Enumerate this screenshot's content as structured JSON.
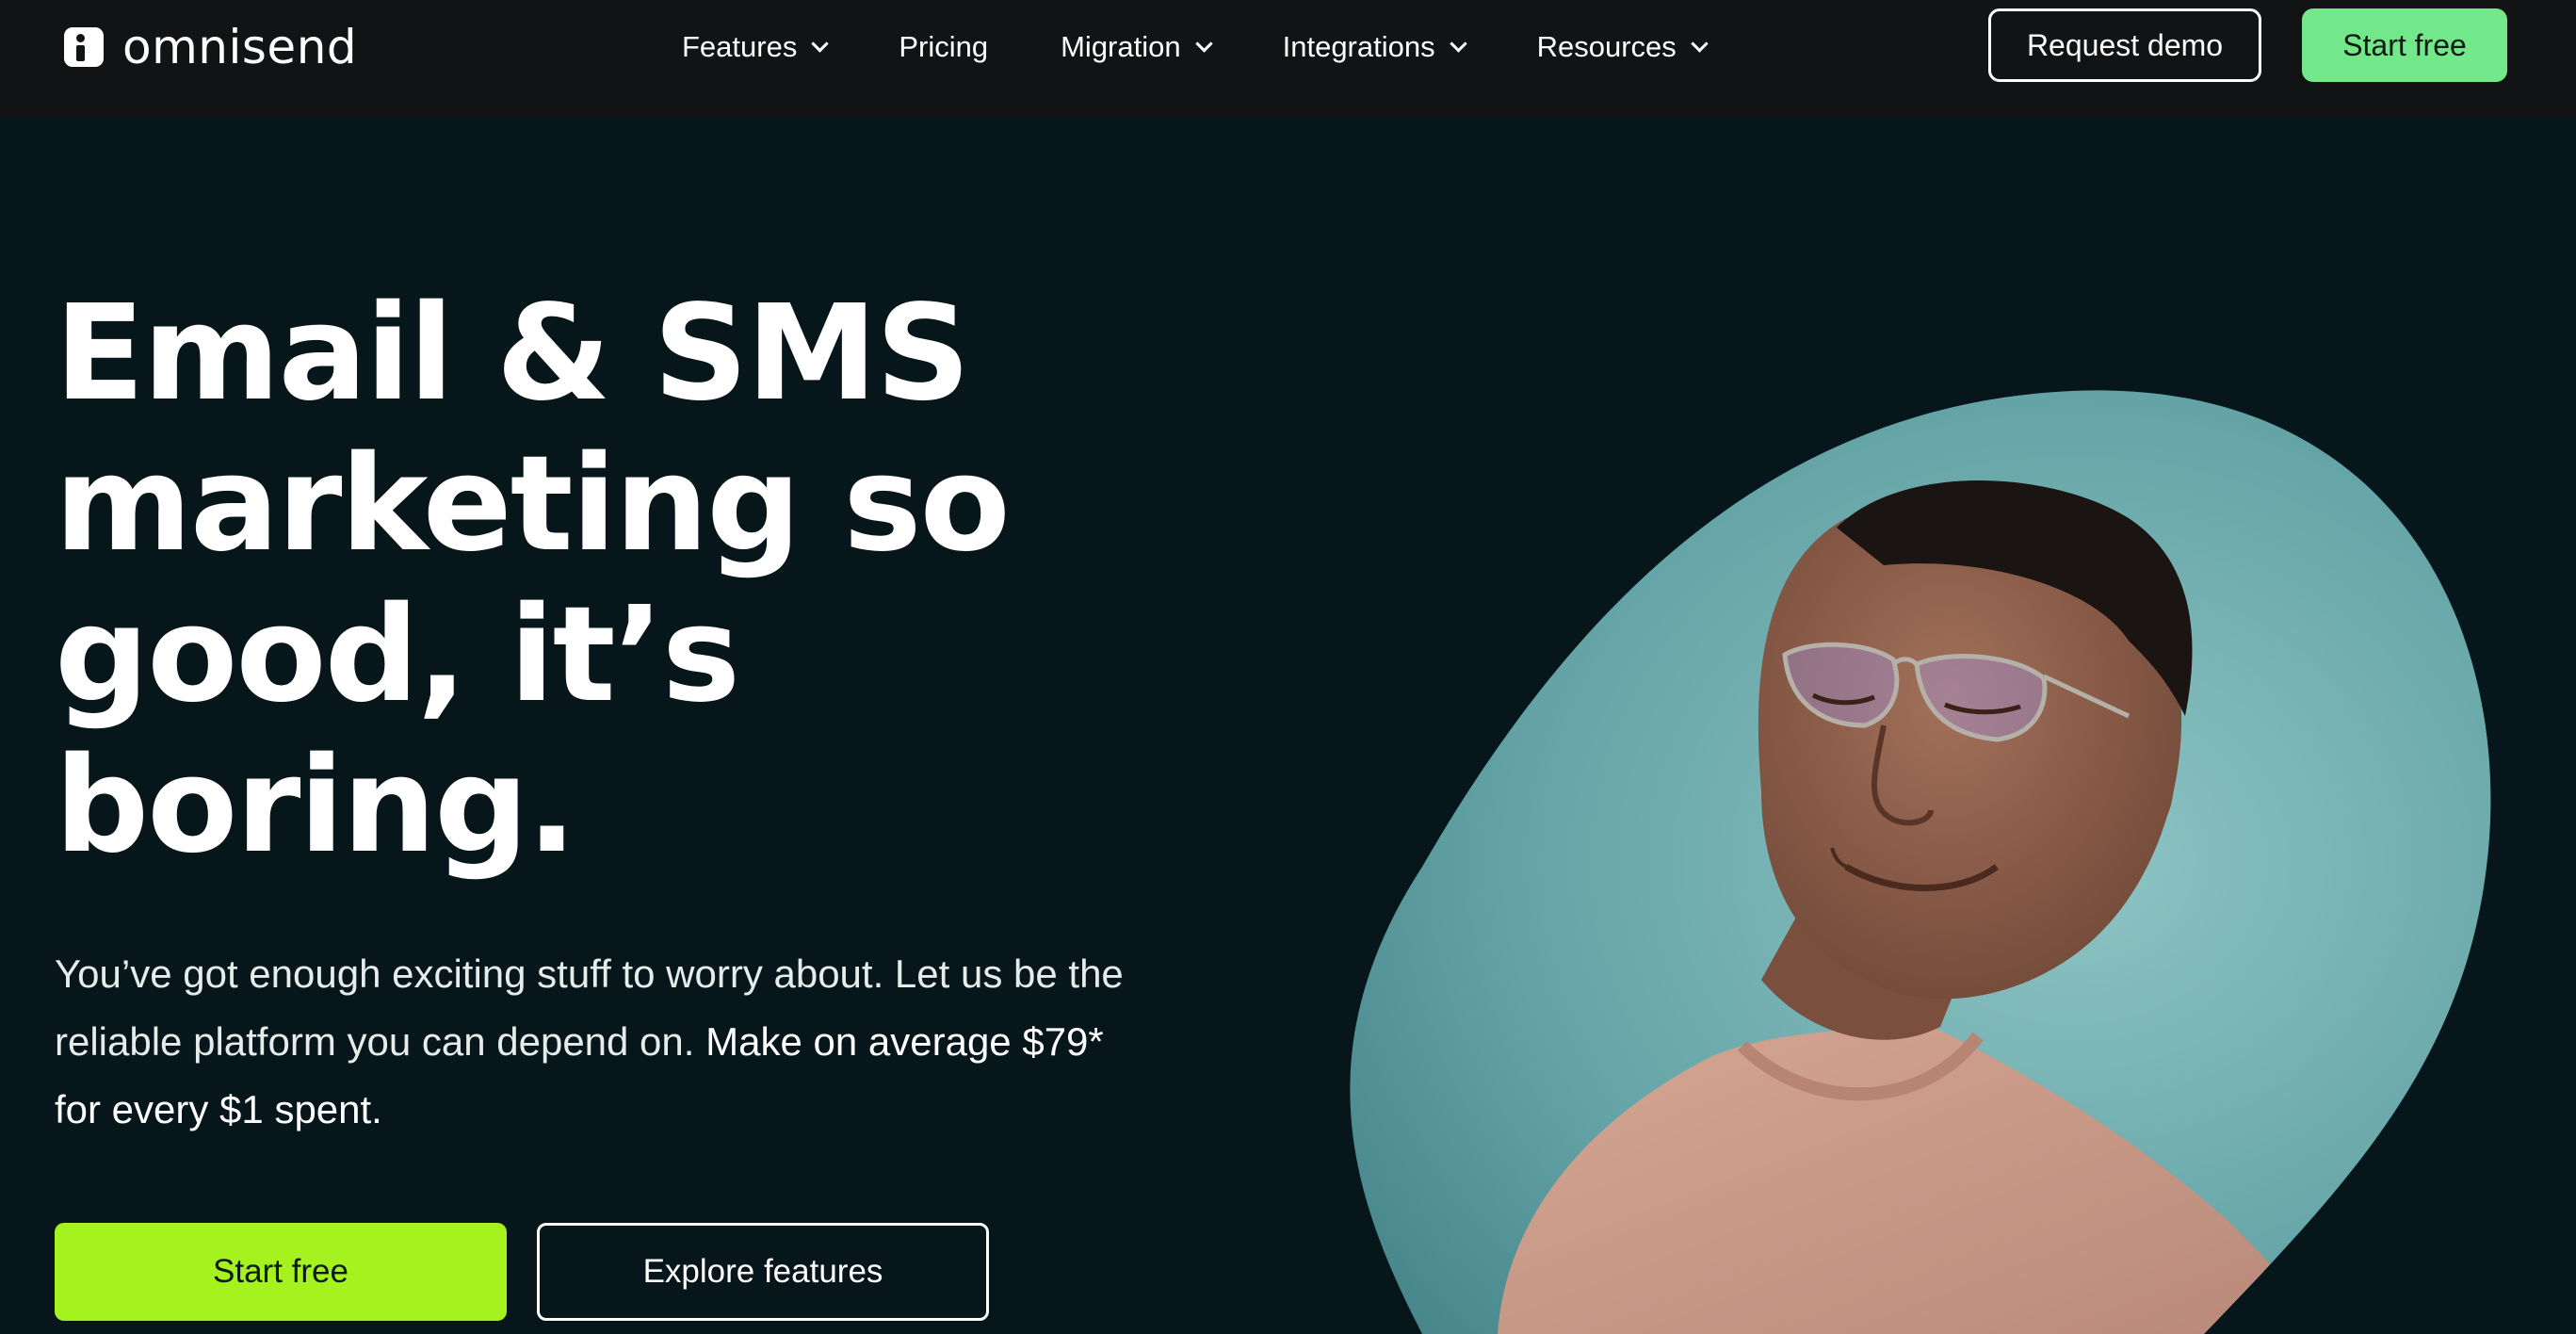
{
  "header": {
    "logo_text": "omnisend",
    "nav": [
      {
        "label": "Features",
        "has_dropdown": true
      },
      {
        "label": "Pricing",
        "has_dropdown": false
      },
      {
        "label": "Migration",
        "has_dropdown": true
      },
      {
        "label": "Integrations",
        "has_dropdown": true
      },
      {
        "label": "Resources",
        "has_dropdown": true
      }
    ],
    "request_demo_label": "Request demo",
    "start_free_label": "Start free"
  },
  "hero": {
    "headline_lines": [
      "Email & SMS",
      "marketing so",
      "good, it’s",
      "boring."
    ],
    "subtext_regular": "You’ve got enough exciting stuff to worry about. Let us be the reliable platform you can depend on. ",
    "subtext_emphasis": "Make on average $79* for every $1 spent.",
    "primary_cta": "Start free",
    "secondary_cta": "Explore features"
  },
  "colors": {
    "topbar_bg": "#121314",
    "page_bg": "#07161a",
    "start_free_top": "#73e88a",
    "start_free_main": "#a6f21e",
    "photo_backdrop": "#5ea3a5",
    "sweater": "#c79a86"
  },
  "icons": {
    "nav_dropdown": "chevron-down-icon",
    "logo": "omnisend-logo-icon"
  }
}
